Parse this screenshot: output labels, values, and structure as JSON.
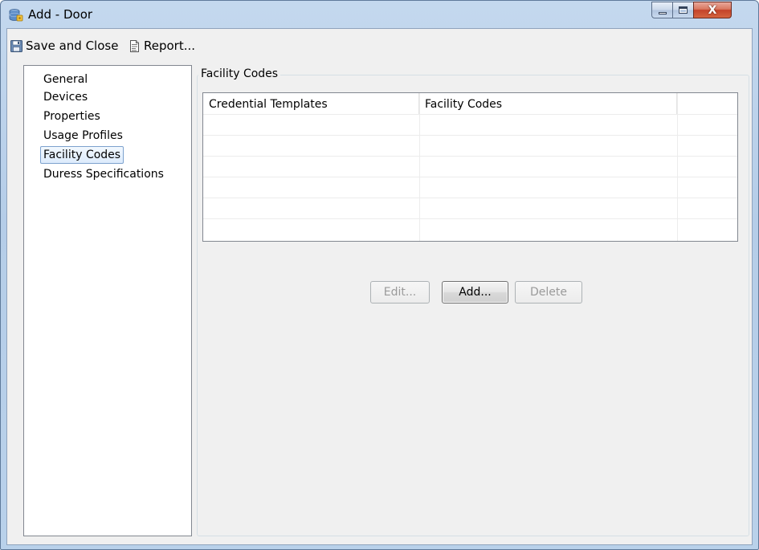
{
  "window": {
    "title": "Add - Door",
    "icon": "database-key-icon",
    "controls": {
      "minimize": "minimize-icon",
      "maximize": "maximize-icon",
      "close": "X"
    }
  },
  "toolbar": {
    "save_close_label": "Save and Close",
    "save_close_icon": "floppy-disk-icon",
    "report_label": "Report...",
    "report_icon": "report-document-icon"
  },
  "nav": {
    "items": [
      {
        "label": "General",
        "selected": false
      },
      {
        "label": "Devices",
        "selected": false
      },
      {
        "label": "Properties",
        "selected": false
      },
      {
        "label": "Usage Profiles",
        "selected": false
      },
      {
        "label": "Facility Codes",
        "selected": true
      },
      {
        "label": "Duress Specifications",
        "selected": false
      }
    ]
  },
  "content": {
    "group_title": "Facility Codes",
    "grid": {
      "columns": [
        "Credential Templates",
        "Facility Codes",
        ""
      ],
      "rows": []
    },
    "buttons": {
      "edit": {
        "label": "Edit...",
        "enabled": false
      },
      "add": {
        "label": "Add...",
        "enabled": true
      },
      "delete": {
        "label": "Delete",
        "enabled": false
      }
    }
  },
  "colors": {
    "selection_fill": "#dcebfc",
    "selection_border": "#7da2ce",
    "close_button": "#c4432a",
    "disabled_text": "#9a9a9a"
  }
}
